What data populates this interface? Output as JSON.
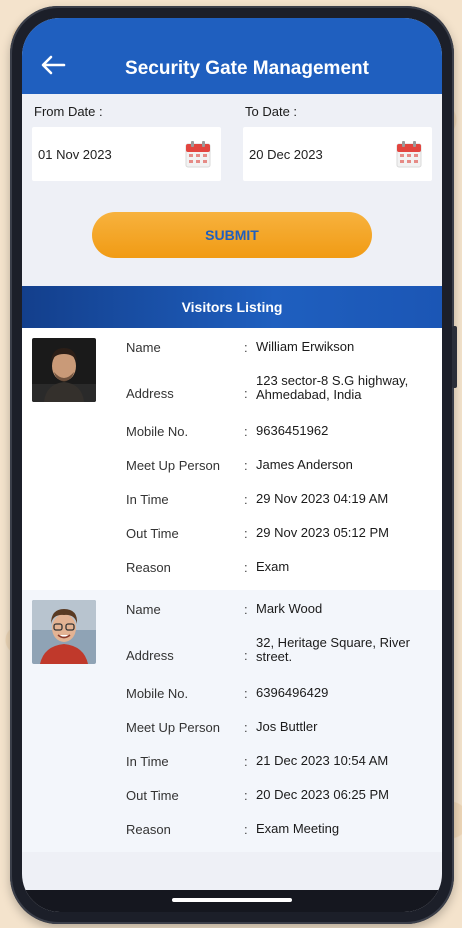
{
  "header": {
    "title": "Security Gate Management"
  },
  "filters": {
    "from_label": "From Date :",
    "from_value": "01 Nov 2023",
    "to_label": "To Date :",
    "to_value": "20 Dec 2023"
  },
  "submit_label": "SUBMIT",
  "listing_title": "Visitors Listing",
  "field_labels": {
    "name": "Name",
    "address": "Address",
    "mobile": "Mobile No.",
    "meet": "Meet Up Person",
    "in_time": "In Time",
    "out_time": "Out Time",
    "reason": "Reason",
    "sep": ":"
  },
  "visitors": [
    {
      "name": "William Erwikson",
      "address": "123 sector-8 S.G highway, Ahmedabad, India",
      "mobile": "9636451962",
      "meet": "James Anderson",
      "in_time": "29 Nov 2023 04:19 AM",
      "out_time": "29 Nov 2023 05:12 PM",
      "reason": "Exam"
    },
    {
      "name": "Mark Wood",
      "address": "32, Heritage Square, River street.",
      "mobile": "6396496429",
      "meet": "Jos Buttler",
      "in_time": "21 Dec 2023 10:54 AM",
      "out_time": "20 Dec 2023 06:25 PM",
      "reason": "Exam Meeting"
    }
  ],
  "colors": {
    "primary": "#1f5fbf",
    "accent": "#f19b14"
  }
}
